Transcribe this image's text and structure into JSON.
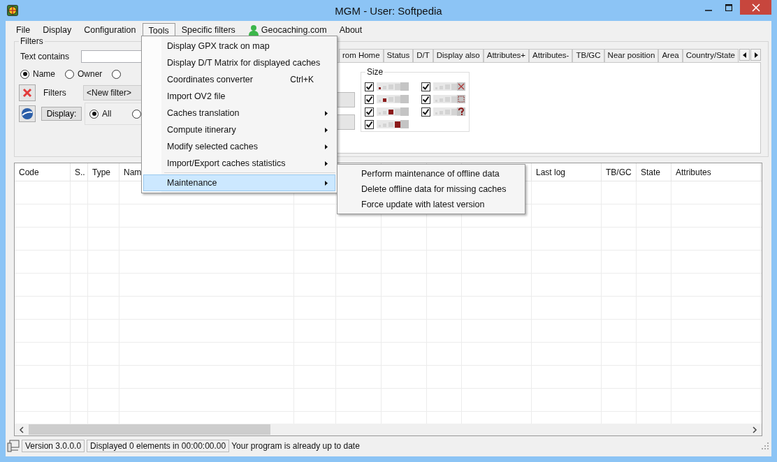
{
  "window": {
    "title": "MGM - User: Softpedia"
  },
  "menu_bar": [
    {
      "label": "File",
      "selected": false
    },
    {
      "label": "Display",
      "selected": false
    },
    {
      "label": "Configuration",
      "selected": false
    },
    {
      "label": "Tools",
      "selected": true
    },
    {
      "label": "Specific filters",
      "selected": false
    },
    {
      "label": "Geocaching.com",
      "selected": false,
      "kind": "user"
    },
    {
      "label": "About",
      "selected": false
    }
  ],
  "tools_menu": [
    {
      "label": "Display GPX track on map",
      "submenu": false,
      "selected": false
    },
    {
      "label": "Display D/T Matrix for displayed caches",
      "submenu": false,
      "selected": false
    },
    {
      "label": "Coordinates converter",
      "shortcut": "Ctrl+K",
      "submenu": false,
      "selected": false
    },
    {
      "label": "Import OV2 file",
      "submenu": false,
      "selected": false
    },
    {
      "label": "Caches translation",
      "submenu": true,
      "selected": false
    },
    {
      "label": "Compute itinerary",
      "submenu": true,
      "selected": false
    },
    {
      "label": "Modify selected caches",
      "submenu": true,
      "selected": false
    },
    {
      "label": "Import/Export caches statistics",
      "submenu": true,
      "selected": false
    },
    {
      "label": "Maintenance",
      "submenu": true,
      "selected": true,
      "separator_before": true
    }
  ],
  "maintenance_submenu": [
    "Perform maintenance of offline data",
    "Delete offline data for missing caches",
    "Force update with latest version"
  ],
  "filters": {
    "title": "Filters",
    "text_label": "Text contains",
    "search_in": [
      {
        "label": "Name",
        "selected": true
      },
      {
        "label": "Owner",
        "selected": false
      },
      {
        "selected": false
      }
    ],
    "filters_label": "Filters",
    "filter_choice": "<New filter>",
    "display_button": "Display:",
    "display_scope": [
      {
        "label": "All",
        "selected": true
      },
      {
        "selected": false
      }
    ]
  },
  "filter_tabs": [
    "rom Home",
    "Status",
    "D/T",
    "Display also",
    "Attributes+",
    "Attributes-",
    "TB/GC",
    "Near position",
    "Area",
    "Country/State"
  ],
  "size_group": {
    "title": "Size",
    "options": [
      {
        "kind": "micro",
        "checked": true
      },
      {
        "kind": "small",
        "checked": true
      },
      {
        "kind": "regular",
        "checked": true
      },
      {
        "kind": "large",
        "checked": true
      },
      {
        "kind": "not_chosen",
        "checked": true
      },
      {
        "kind": "virtual",
        "checked": true
      },
      {
        "kind": "other",
        "checked": true
      }
    ]
  },
  "table": {
    "columns": [
      {
        "label": "Code"
      },
      {
        "label": "S.."
      },
      {
        "label": "Type"
      },
      {
        "label": "Nam"
      },
      {},
      {},
      {},
      {},
      {},
      {
        "label": "Last log"
      },
      {
        "label": "TB/GC"
      },
      {
        "label": "State"
      },
      {
        "label": "Attributes"
      }
    ]
  },
  "status_bar": {
    "version": "Version 3.0.0.0",
    "displayed": "Displayed 0 elements in 00:00:00.00",
    "message": "Your program is already up to date"
  }
}
